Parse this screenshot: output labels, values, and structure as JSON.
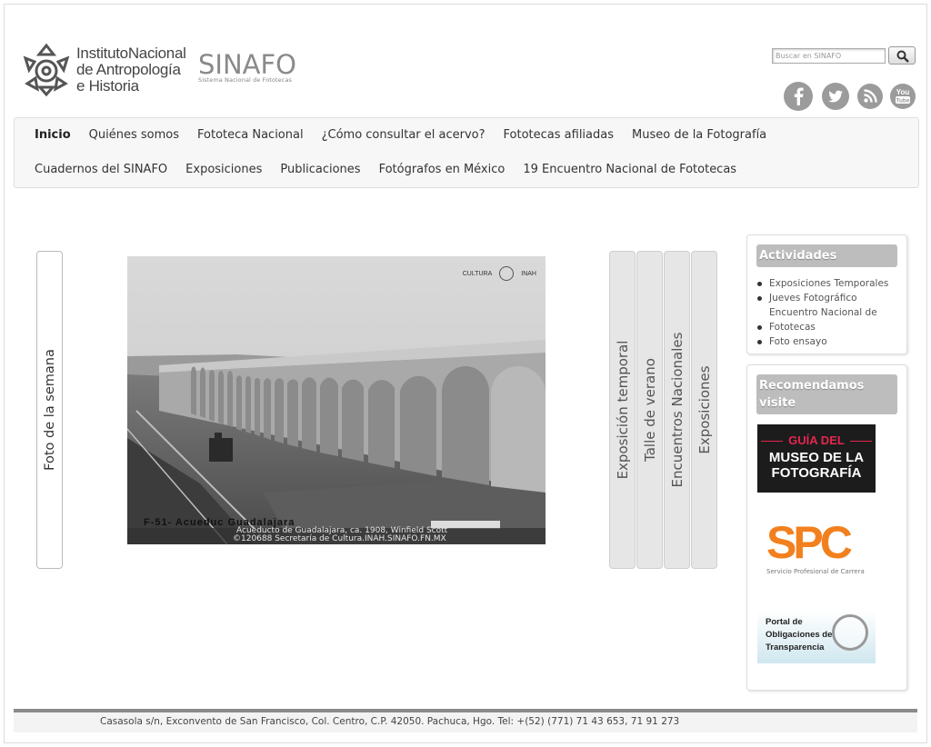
{
  "header": {
    "inah_logo_text": [
      "InstitutoNacional",
      "de Antropología",
      "e Historia"
    ],
    "sinafo_name": "SINAFO",
    "sinafo_subtitle": "Sistema Nacional de Fototecas",
    "search": {
      "placeholder": "Buscar en SINAFO",
      "button_icon": "search-icon"
    },
    "social": [
      "facebook-icon",
      "twitter-icon",
      "rss-icon",
      "youtube-icon"
    ]
  },
  "nav": {
    "row1": [
      "Inicio",
      "Quiénes somos",
      "Fototeca Nacional",
      "¿Cómo consultar el acervo?",
      "Fototecas afiliadas",
      "Museo de la Fotografía"
    ],
    "row2": [
      "Cuadernos del SINAFO",
      "Exposiciones",
      "Publicaciones",
      "Fotógrafos en México",
      "19 Encuentro Nacional de Fototecas"
    ],
    "active": "Inicio"
  },
  "foto_semana": {
    "tab_label": "Foto de la semana",
    "photo_brand": [
      "CULTURA",
      "INAH"
    ],
    "negative_label": "F-51-  Acueduc Guadalajara",
    "caption_line1": "Acueducto de Guadalajara, ca. 1908, Winfield Scott",
    "caption_line2": "©120688 Secretaría de Cultura.INAH.SINAFO.FN.MX"
  },
  "side_tabs": [
    "Exposición temporal",
    "Talle de verano",
    "Encuentros Nacionales",
    "Exposiciones"
  ],
  "actividades": {
    "title": "Actividades",
    "items": [
      {
        "label": "Exposiciones Temporales"
      },
      {
        "label": "Jueves Fotográfico"
      },
      {
        "label": "Encuentro Nacional de Fototecas"
      },
      {
        "label": "Foto ensayo"
      }
    ],
    "encuentro_line1": "Encuentro Nacional de",
    "encuentro_line2": "Fototecas"
  },
  "recomendamos": {
    "title": "Recomendamos visite",
    "guia_line1": "GUÍA DEL",
    "guia_line2": "MUSEO DE LA FOTOGRAFÍA",
    "spc_logo": "SPC",
    "spc_sub": "Servicio Profesional de Carrera",
    "pot_text": [
      "Portal de",
      "Obligaciones de",
      "Transparencia"
    ]
  },
  "footer": {
    "address": "Casasola s/n, Exconvento de San Francisco, Col. Centro, C.P. 42050. Pachuca, Hgo. Tel: +(52) (771) 71 43 653, 71 91 273"
  },
  "colors": {
    "accent_grey": "#bdbdbd",
    "spc_orange": "#f2801e",
    "guia_red": "#e3274f"
  }
}
